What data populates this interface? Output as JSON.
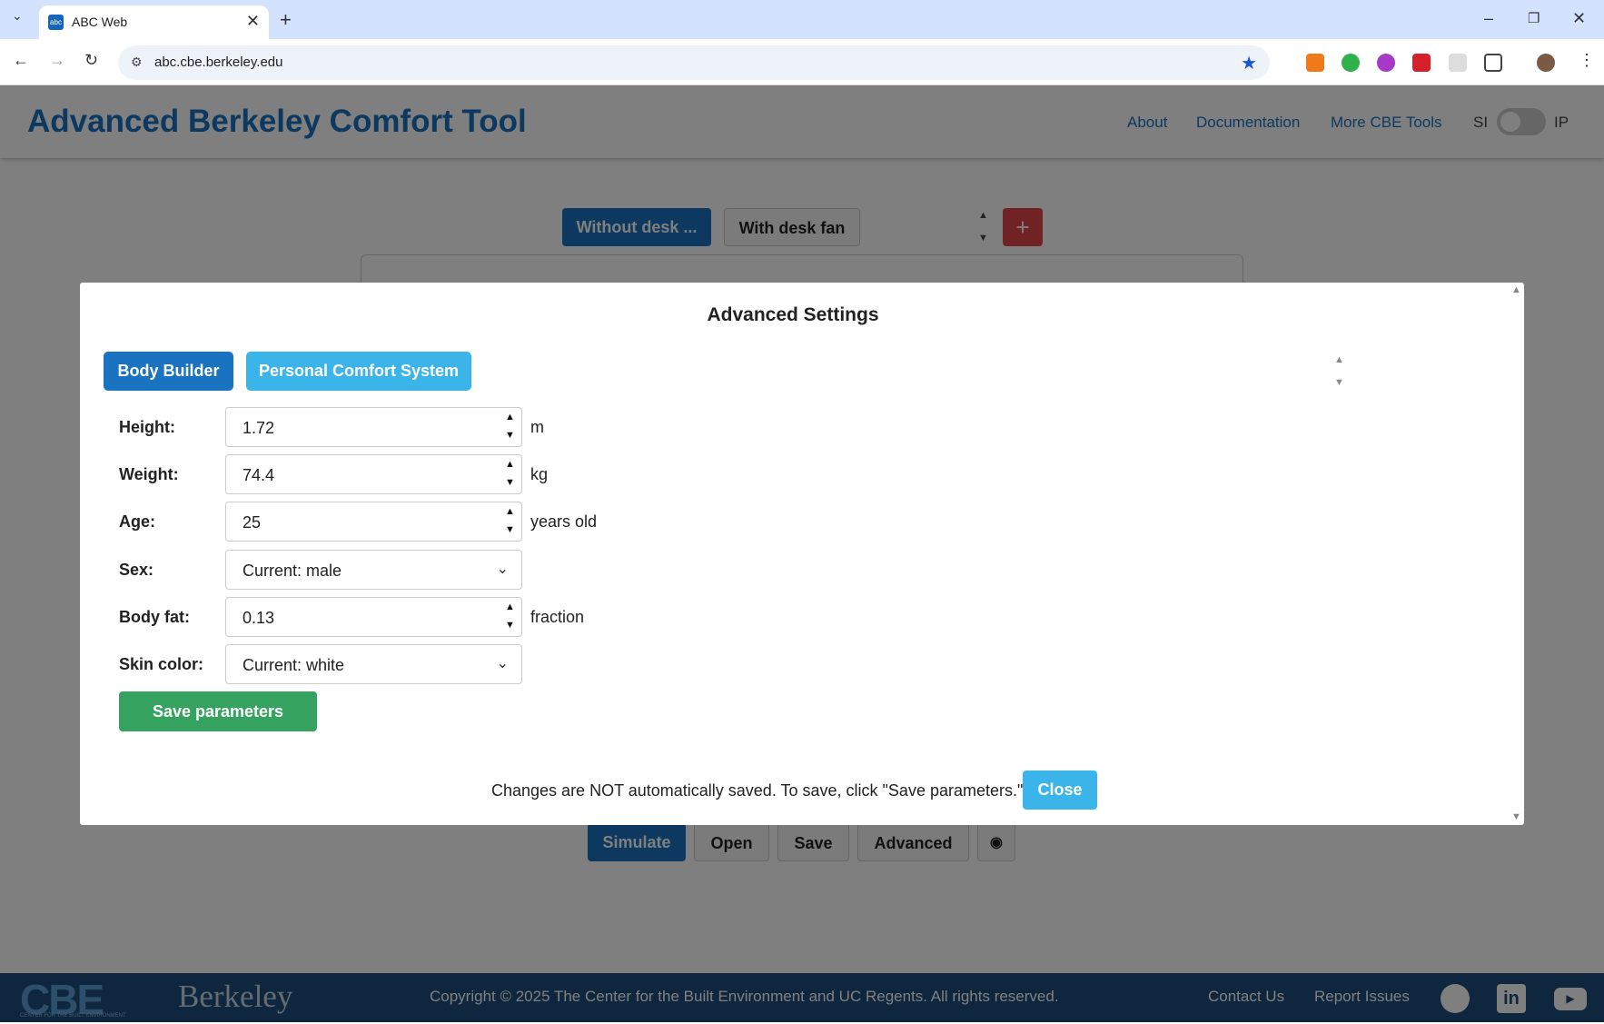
{
  "browser": {
    "tab_title": "ABC Web",
    "favicon_text": "abc",
    "url": "abc.cbe.berkeley.edu",
    "new_tab_glyph": "+",
    "close_tab_glyph": "✕"
  },
  "header": {
    "title": "Advanced Berkeley Comfort Tool",
    "nav": [
      "About",
      "Documentation",
      "More CBE Tools"
    ],
    "unit_left": "SI",
    "unit_right": "IP"
  },
  "scenario_tabs": [
    "Without desk ...",
    "With desk fan"
  ],
  "bottom_buttons": [
    "Simulate",
    "Open",
    "Save",
    "Advanced"
  ],
  "modal": {
    "title": "Advanced Settings",
    "tabs": [
      "Body Builder",
      "Personal Comfort System"
    ],
    "fields": [
      {
        "label": "Height:",
        "value": "1.72",
        "unit": "m"
      },
      {
        "label": "Weight:",
        "value": "74.4",
        "unit": "kg"
      },
      {
        "label": "Age:",
        "value": "25",
        "unit": "years old"
      },
      {
        "label": "Sex:",
        "value": "Current: male",
        "unit": ""
      },
      {
        "label": "Body fat:",
        "value": "0.13",
        "unit": "fraction"
      },
      {
        "label": "Skin color:",
        "value": "Current: white",
        "unit": ""
      }
    ],
    "save_label": "Save parameters",
    "note": "Changes are NOT automatically saved. To save, click \"Save parameters.\"",
    "close_label": "Close"
  },
  "footer": {
    "logo_cbe": "CBE",
    "logo_cbe_sub": "CENTER FOR THE BUILT ENVIRONMENT",
    "logo_berkeley": "Berkeley",
    "copyright": "Copyright © 2025 The Center for the Built Environment and UC Regents. All rights reserved.",
    "links": [
      "Contact Us",
      "Report Issues"
    ],
    "icons": [
      "github-icon",
      "linkedin-icon",
      "youtube-icon"
    ]
  },
  "colors": {
    "brand_blue": "#1a73c0",
    "dark_blue": "#1d4f7c",
    "green": "#35a35f",
    "light_blue": "#3bb4ea",
    "red": "#e0454a"
  }
}
